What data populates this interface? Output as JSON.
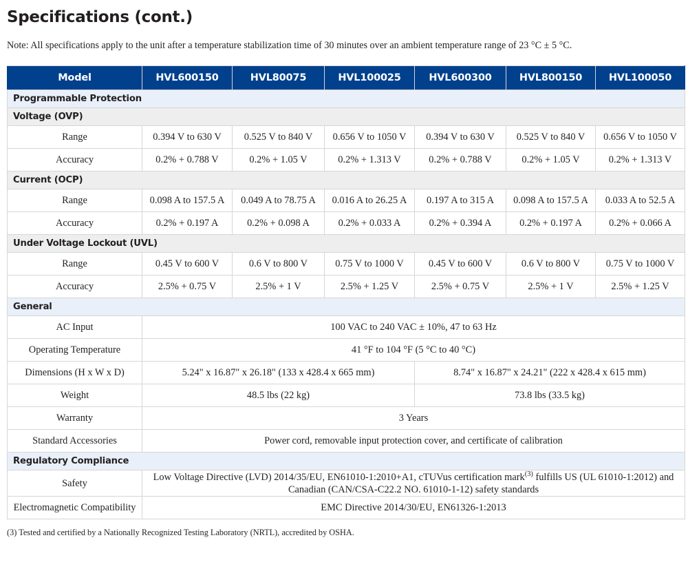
{
  "title": "Specifications (cont.)",
  "note": "Note: All specifications apply to the unit after a temperature stabilization time of 30 minutes over an ambient temperature range of 23 °C ± 5 °C.",
  "footnote": "(3) Tested and certified by a Nationally Recognized Testing Laboratory (NRTL), accredited by OSHA.",
  "colors": {
    "header_blue": "#01408C",
    "section_major_bg": "#E9F0F9",
    "section_sub_bg": "#EEEEEE",
    "border": "#d6d6d6",
    "text": "#231f20"
  },
  "table": {
    "header": {
      "model_label": "Model",
      "models": [
        "HVL600150",
        "HVL80075",
        "HVL100025",
        "HVL600300",
        "HVL800150",
        "HVL100050"
      ]
    },
    "sections": [
      {
        "kind": "major",
        "label": "Programmable Protection"
      },
      {
        "kind": "sub",
        "label": "Voltage (OVP)"
      },
      {
        "kind": "row",
        "label": "Range",
        "values": [
          "0.394 V to 630 V",
          "0.525 V to 840 V",
          "0.656 V to 1050 V",
          "0.394 V to 630 V",
          "0.525 V to 840 V",
          "0.656 V to 1050 V"
        ]
      },
      {
        "kind": "row",
        "label": "Accuracy",
        "values": [
          "0.2% + 0.788 V",
          "0.2% + 1.05 V",
          "0.2% + 1.313 V",
          "0.2% + 0.788 V",
          "0.2% + 1.05 V",
          "0.2% + 1.313 V"
        ]
      },
      {
        "kind": "sub",
        "label": "Current (OCP)"
      },
      {
        "kind": "row",
        "label": "Range",
        "values": [
          "0.098 A to 157.5 A",
          "0.049 A to 78.75 A",
          "0.016 A to 26.25 A",
          "0.197 A to 315 A",
          "0.098 A to 157.5 A",
          "0.033 A to 52.5 A"
        ]
      },
      {
        "kind": "row",
        "label": "Accuracy",
        "values": [
          "0.2% + 0.197 A",
          "0.2% + 0.098 A",
          "0.2% + 0.033 A",
          "0.2% + 0.394 A",
          "0.2% + 0.197 A",
          "0.2% + 0.066 A"
        ]
      },
      {
        "kind": "sub",
        "label": "Under Voltage Lockout (UVL)"
      },
      {
        "kind": "row",
        "label": "Range",
        "values": [
          "0.45 V to 600 V",
          "0.6 V to 800 V",
          "0.75 V to 1000 V",
          "0.45 V to 600 V",
          "0.6 V to 800 V",
          "0.75 V to 1000 V"
        ]
      },
      {
        "kind": "row",
        "label": "Accuracy",
        "values": [
          "2.5% + 0.75 V",
          "2.5% + 1 V",
          "2.5% + 1.25 V",
          "2.5% + 0.75 V",
          "2.5% + 1 V",
          "2.5% + 1.25 V"
        ]
      },
      {
        "kind": "major",
        "label": "General"
      },
      {
        "kind": "row-span6",
        "label": "AC Input",
        "value": "100 VAC to 240 VAC ± 10%, 47 to 63 Hz"
      },
      {
        "kind": "row-span6",
        "label": "Operating Temperature",
        "value": "41 °F to 104 °F (5 °C to 40 °C)"
      },
      {
        "kind": "row-split",
        "label": "Dimensions (H x W x D)",
        "value_left": "5.24\" x 16.87\" x 26.18\" (133 x 428.4 x 665 mm)",
        "value_right": "8.74\" x 16.87\" x 24.21\" (222 x 428.4 x 615 mm)"
      },
      {
        "kind": "row-split",
        "label": "Weight",
        "value_left": "48.5 lbs (22 kg)",
        "value_right": "73.8 lbs (33.5 kg)"
      },
      {
        "kind": "row-span6",
        "label": "Warranty",
        "value": "3 Years"
      },
      {
        "kind": "row-span6",
        "label": "Standard Accessories",
        "value": "Power cord, removable input protection cover, and certificate of calibration"
      },
      {
        "kind": "major",
        "label": "Regulatory Compliance"
      },
      {
        "kind": "row-safety",
        "label": "Safety",
        "value_part1": "Low Voltage Directive (LVD) 2014/35/EU, EN61010-1:2010+A1, cTUVus certification mark",
        "value_superscript": "(3)",
        "value_part2": " fulfills US (UL 61010-1:2012) and Canadian (CAN/CSA-C22.2 NO. 61010-1-12) safety standards"
      },
      {
        "kind": "row-span6",
        "label": "Electromagnetic Compatibility",
        "value": "EMC Directive 2014/30/EU, EN61326-1:2013"
      }
    ]
  }
}
